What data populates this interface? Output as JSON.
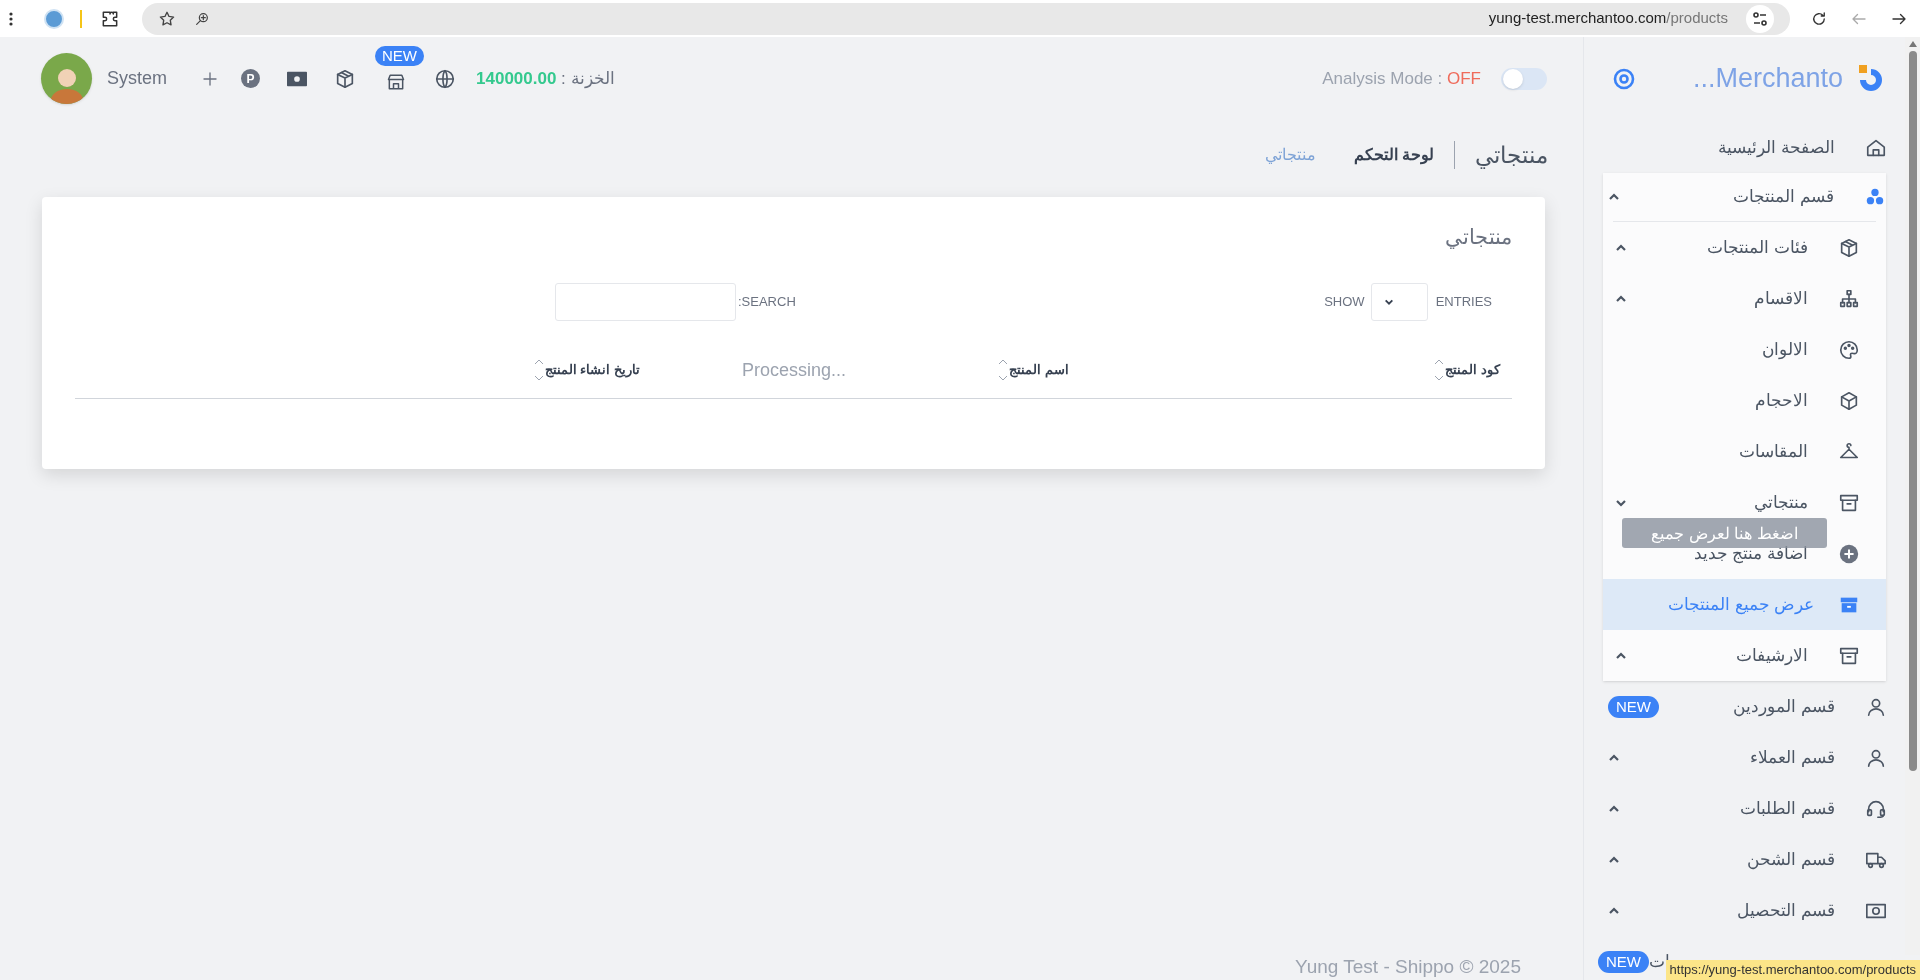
{
  "browser": {
    "url_domain": "yung-test.merchantoo.com",
    "url_path": "/products",
    "status_url": "https://yung-test.merchantoo.com/products"
  },
  "header": {
    "user": "System",
    "new_badge": "NEW",
    "parking_icon": "P",
    "treasury_label": "الخزنة :",
    "treasury_value": "140000.00",
    "analysis_label": "Analysis Mode :",
    "analysis_value": "OFF",
    "analysis_on": false
  },
  "sidebar": {
    "brand": "...Merchanto",
    "tooltip": "اضغط هنا لعرض جميع",
    "items": [
      {
        "label": "الصفحة الرئيسية",
        "open": false,
        "selected": false
      },
      {
        "label": "قسم المنتجات",
        "open": true,
        "selected": false,
        "expanded": false,
        "children": [
          {
            "label": "فئات المنتجات",
            "selected": false,
            "expanded": false
          },
          {
            "label": "الاقسام",
            "selected": false,
            "expanded": false
          },
          {
            "label": "الالوان",
            "selected": false
          },
          {
            "label": "الاحجام",
            "selected": false
          },
          {
            "label": "المقاسات",
            "selected": false
          },
          {
            "label": "منتجاتي",
            "selected": false,
            "expanded": true,
            "children": [
              {
                "label": "اضافة منتج جديد",
                "selected": false
              },
              {
                "label": "عرض جميع المنتجات",
                "selected": true
              }
            ]
          },
          {
            "label": "الارشيفات",
            "selected": false,
            "expanded": false
          }
        ]
      },
      {
        "label": "قسم الموردين",
        "open": false,
        "selected": false,
        "badge": "NEW"
      },
      {
        "label": "قسم العملاء",
        "open": false,
        "selected": false,
        "expanded": false
      },
      {
        "label": "قسم الطلبات",
        "open": false,
        "selected": false,
        "expanded": false
      },
      {
        "label": "قسم الشحن",
        "open": false,
        "selected": false,
        "expanded": false
      },
      {
        "label": "قسم التحصيل",
        "open": false,
        "selected": false,
        "expanded": false
      },
      {
        "label": "ات",
        "open": false,
        "selected": false,
        "badge": "NEW"
      }
    ]
  },
  "breadcrumb": {
    "title": "منتجاتي",
    "items": [
      {
        "label": "لوحة التحكم",
        "selected": false
      },
      {
        "label": "منتجاتي",
        "selected": true
      }
    ]
  },
  "card": {
    "title": "منتجاتي",
    "entries_label": "ENTRIES",
    "show_label": "SHOW",
    "search_label": ":SEARCH",
    "processing": "Processing...",
    "columns": [
      "كود المنتج",
      "اسم المنتج",
      "تاريخ انشاء المنتج"
    ]
  },
  "footer": "Yung Test - Shippo © 2025"
}
